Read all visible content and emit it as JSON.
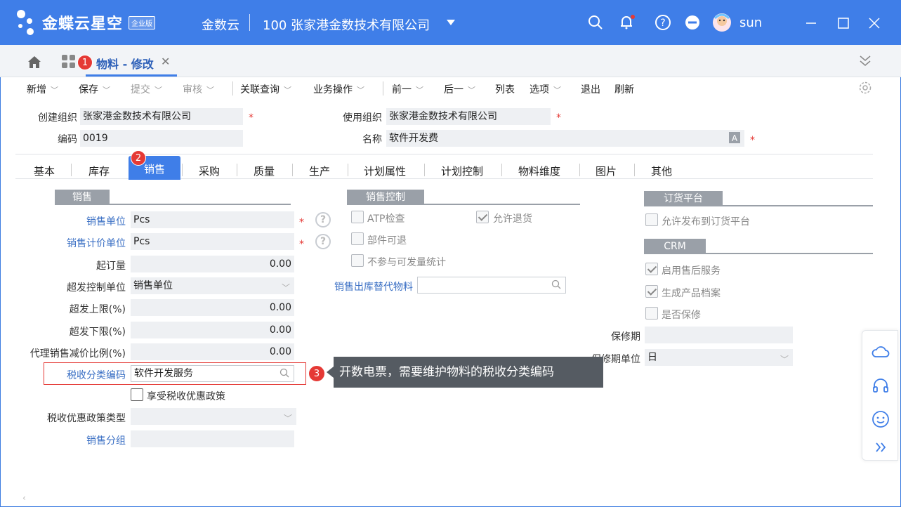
{
  "app": {
    "logo_text": "金蝶云星空",
    "edition_badge": "企业版",
    "cloud_name": "金数云",
    "company": "100  张家港金数技术有限公司",
    "username": "sun",
    "brand_color": "#3f7ee8"
  },
  "tabs": {
    "doc_tab_label": "物料 - 修改",
    "badge1": "1"
  },
  "toolbar": {
    "new": "新增",
    "save": "保存",
    "submit": "提交",
    "audit": "审核",
    "related_query": "关联查询",
    "business_ops": "业务操作",
    "prev": "前一",
    "next": "后一",
    "list": "列表",
    "options": "选项",
    "exit": "退出",
    "refresh": "刷新"
  },
  "header_form": {
    "create_org_label": "创建组织",
    "create_org_value": "张家港金数技术有限公司",
    "use_org_label": "使用组织",
    "use_org_value": "张家港金数技术有限公司",
    "code_label": "编码",
    "code_value": "0019",
    "name_label": "名称",
    "name_value": "软件开发费"
  },
  "subtabs": {
    "basic": "基本",
    "inventory": "库存",
    "sales": "销售",
    "purchase": "采购",
    "quality": "质量",
    "production": "生产",
    "plan_attr": "计划属性",
    "plan_control": "计划控制",
    "material_dim": "物料维度",
    "image": "图片",
    "other": "其他",
    "badge2": "2"
  },
  "sales_section": {
    "title": "销售",
    "sales_unit_label": "销售单位",
    "sales_unit_value": "Pcs",
    "sales_price_unit_label": "销售计价单位",
    "sales_price_unit_value": "Pcs",
    "min_order_label": "起订量",
    "min_order_value": "0.00",
    "over_ctrl_unit_label": "超发控制单位",
    "over_ctrl_unit_value": "销售单位",
    "over_upper_label": "超发上限(%)",
    "over_upper_value": "0.00",
    "over_lower_label": "超发下限(%)",
    "over_lower_value": "0.00",
    "agent_discount_label": "代理销售减价比例(%)",
    "agent_discount_value": "0.00",
    "tax_code_label": "税收分类编码",
    "tax_code_value": "软件开发服务",
    "tax_pref_label": "享受税收优惠政策",
    "tax_pref_type_label": "税收优惠政策类型",
    "sales_group_label": "销售分组"
  },
  "sales_control": {
    "title": "销售控制",
    "atp_check": "ATP检查",
    "allow_return": "允许退货",
    "part_return": "部件可退",
    "no_avail_stat": "不参与可发量统计",
    "sub_material_label": "销售出库替代物料"
  },
  "order_platform": {
    "title": "订货平台",
    "allow_publish": "允许发布到订货平台"
  },
  "crm": {
    "title": "CRM",
    "enable_after_sales": "启用售后服务",
    "gen_product_file": "生成产品档案",
    "is_warranty": "是否保修",
    "warranty_period_label": "保修期",
    "warranty_unit_label": "保修期单位",
    "warranty_unit_value": "日"
  },
  "annotation": {
    "badge3": "3",
    "tooltip": "开数电票，需要维护物料的税收分类编码"
  }
}
